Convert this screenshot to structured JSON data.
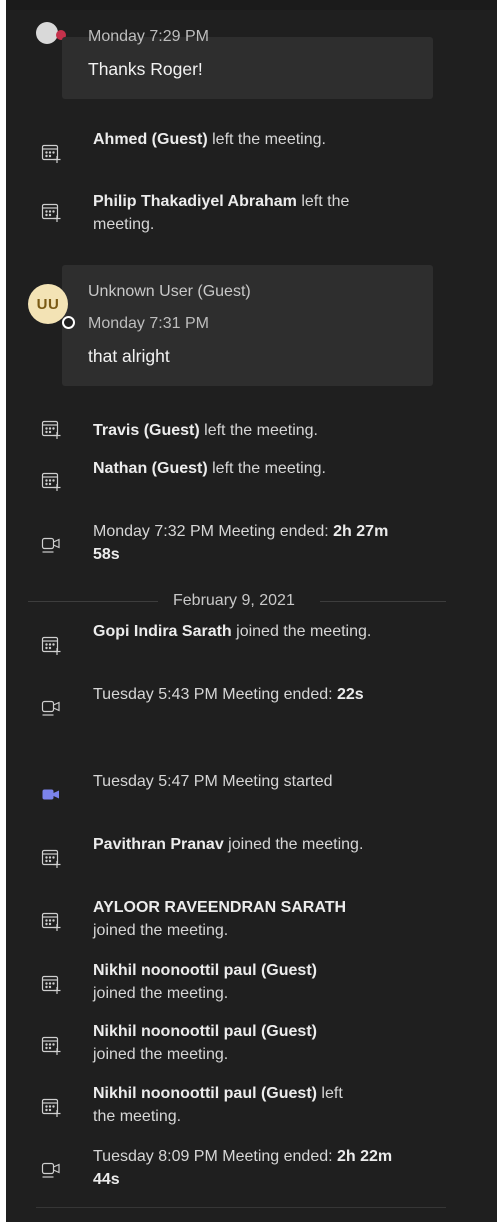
{
  "messages": [
    {
      "sender": "",
      "time": "Monday 7:29 PM",
      "text": "Thanks Roger!"
    },
    {
      "avatar_initials": "UU",
      "sender": "Unknown User (Guest)",
      "time": "Monday 7:31 PM",
      "text": "that alright"
    }
  ],
  "events": [
    {
      "icon": "calendar-add-icon",
      "bold": "Ahmed (Guest)",
      "text": " left the meeting."
    },
    {
      "icon": "calendar-add-icon",
      "bold": "Philip Thakadiyel Abraham",
      "text": " left the meeting."
    },
    {
      "icon": "calendar-add-icon",
      "bold": "Travis (Guest)",
      "text": " left the meeting."
    },
    {
      "icon": "calendar-add-icon",
      "bold": "Nathan (Guest)",
      "text": " left the meeting."
    },
    {
      "icon": "video-camera-icon",
      "pre": "Monday 7:32 PM   Meeting ended: ",
      "bold_end": "2h 27m 58s"
    },
    {
      "icon": "calendar-add-icon",
      "bold": "Gopi Indira Sarath",
      "text": " joined the meeting."
    },
    {
      "icon": "video-camera-icon",
      "pre": "Tuesday 5:43 PM   Meeting ended: ",
      "bold_end": "22s"
    },
    {
      "icon": "video-camera-filled-icon",
      "pre": "Tuesday 5:47 PM   Meeting started",
      "bold_end": ""
    },
    {
      "icon": "calendar-add-icon",
      "bold": "Pavithran Pranav",
      "text": " joined the meeting."
    },
    {
      "icon": "calendar-add-icon",
      "bold": "AYLOOR RAVEENDRAN SARATH",
      "text": " joined the meeting."
    },
    {
      "icon": "calendar-add-icon",
      "bold": "Nikhil noonoottil paul (Guest)",
      "text": " joined the meeting."
    },
    {
      "icon": "calendar-add-icon",
      "bold": "Nikhil noonoottil paul (Guest)",
      "text": " joined the meeting."
    },
    {
      "icon": "calendar-add-icon",
      "bold": "Nikhil noonoottil paul (Guest)",
      "text": " left the meeting."
    },
    {
      "icon": "video-camera-icon",
      "pre": "Tuesday 8:09 PM   Meeting ended: ",
      "bold_end": "2h 22m 44s"
    }
  ],
  "date_divider": "February 9, 2021",
  "colors": {
    "background": "#1f1f1f",
    "bubble": "#2e2e2e",
    "avatar": "#f3e3b5",
    "meeting_started_icon": "#7b83eb"
  }
}
